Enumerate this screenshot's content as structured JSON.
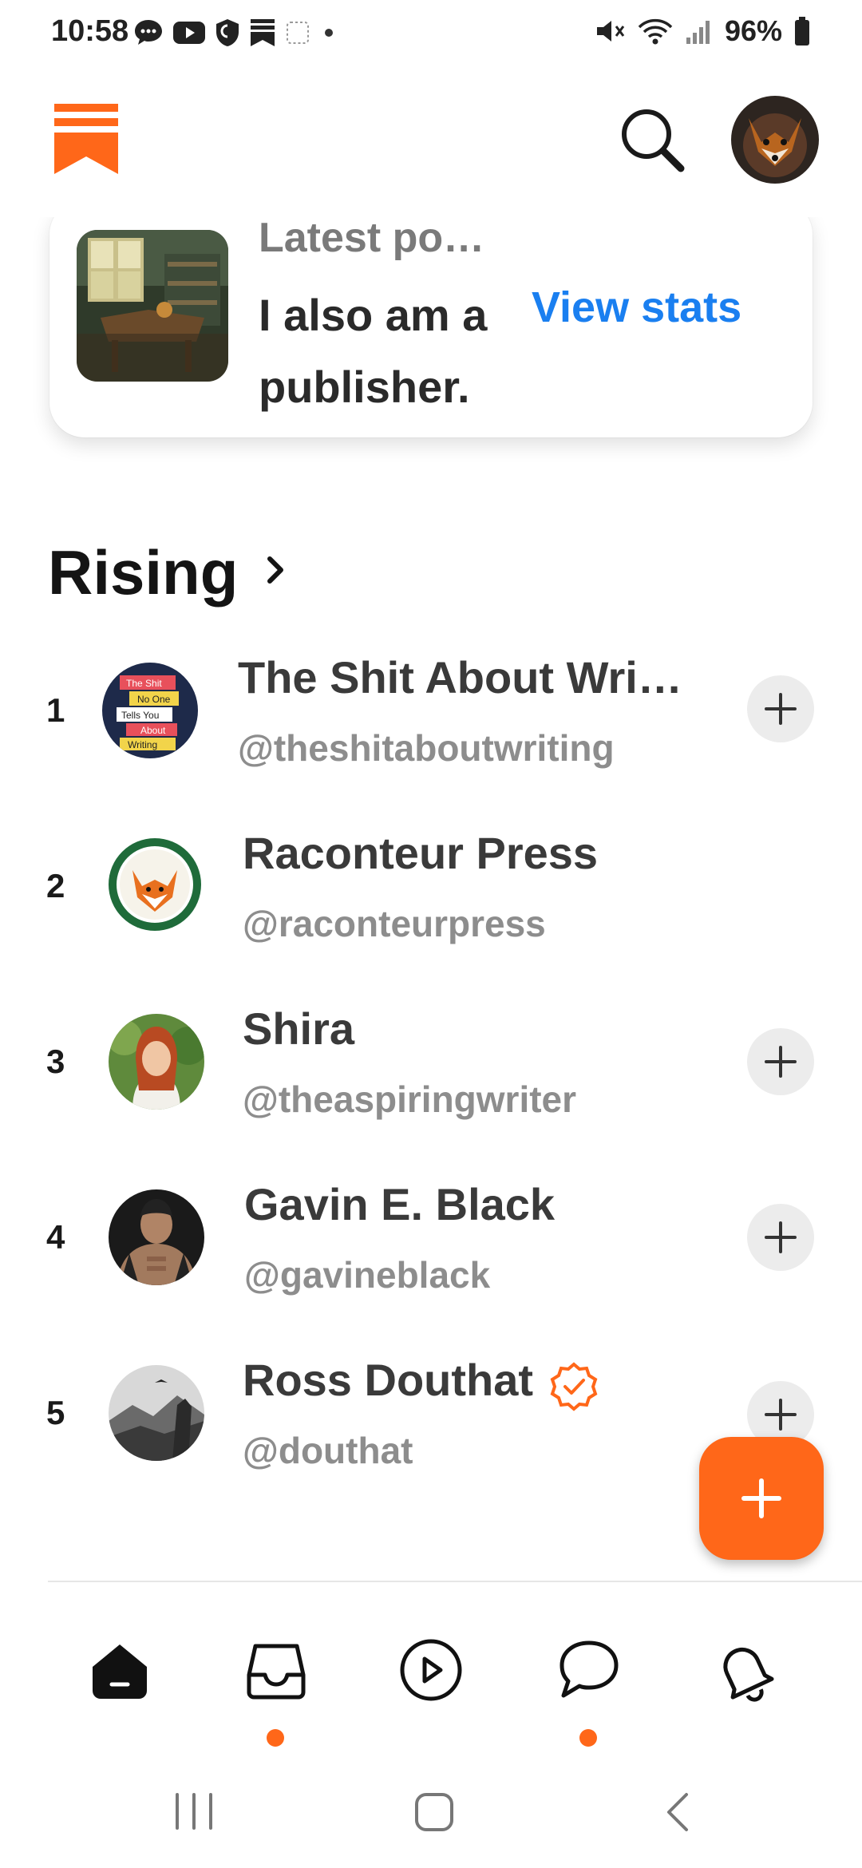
{
  "status_bar": {
    "time": "10:58",
    "battery": "96%",
    "left_icons": [
      "chat-icon",
      "youtube-icon",
      "shield-icon",
      "bookmark-icon",
      "notification-icon",
      "dot-icon"
    ],
    "right_icons": [
      "mute-icon",
      "wifi-icon",
      "signal-icon",
      "battery-icon"
    ]
  },
  "header": {
    "logo": "substack-logo",
    "search_icon": "search-icon",
    "avatar": "profile-avatar"
  },
  "top_card": {
    "kicker": "Latest po…",
    "title": "I also am a publisher.",
    "stats_link": "View stats"
  },
  "rising": {
    "heading": "Rising",
    "items": [
      {
        "rank": "1",
        "name": "The Shit About Wri…",
        "handle": "@theshitaboutwriting",
        "follow": true,
        "verified": false
      },
      {
        "rank": "2",
        "name": "Raconteur Press",
        "handle": "@raconteurpress",
        "follow": false,
        "verified": false
      },
      {
        "rank": "3",
        "name": "Shira",
        "handle": "@theaspiringwriter",
        "follow": true,
        "verified": false
      },
      {
        "rank": "4",
        "name": "Gavin E. Black",
        "handle": "@gavineblack",
        "follow": true,
        "verified": false
      },
      {
        "rank": "5",
        "name": "Ross Douthat",
        "handle": "@douthat",
        "follow": true,
        "verified": true
      }
    ],
    "book_cover_lines": [
      "The Shit",
      "No One",
      "Tells You",
      "About",
      "Writing"
    ]
  },
  "bottom_nav": {
    "items": [
      "home-icon",
      "inbox-icon",
      "play-icon",
      "chat-icon",
      "bell-icon"
    ],
    "badges": [
      false,
      true,
      false,
      true,
      false
    ]
  },
  "colors": {
    "accent": "#ff6719",
    "link": "#1a7ff0",
    "text_primary": "#3a3a3a",
    "text_secondary": "#8d8d8d"
  }
}
